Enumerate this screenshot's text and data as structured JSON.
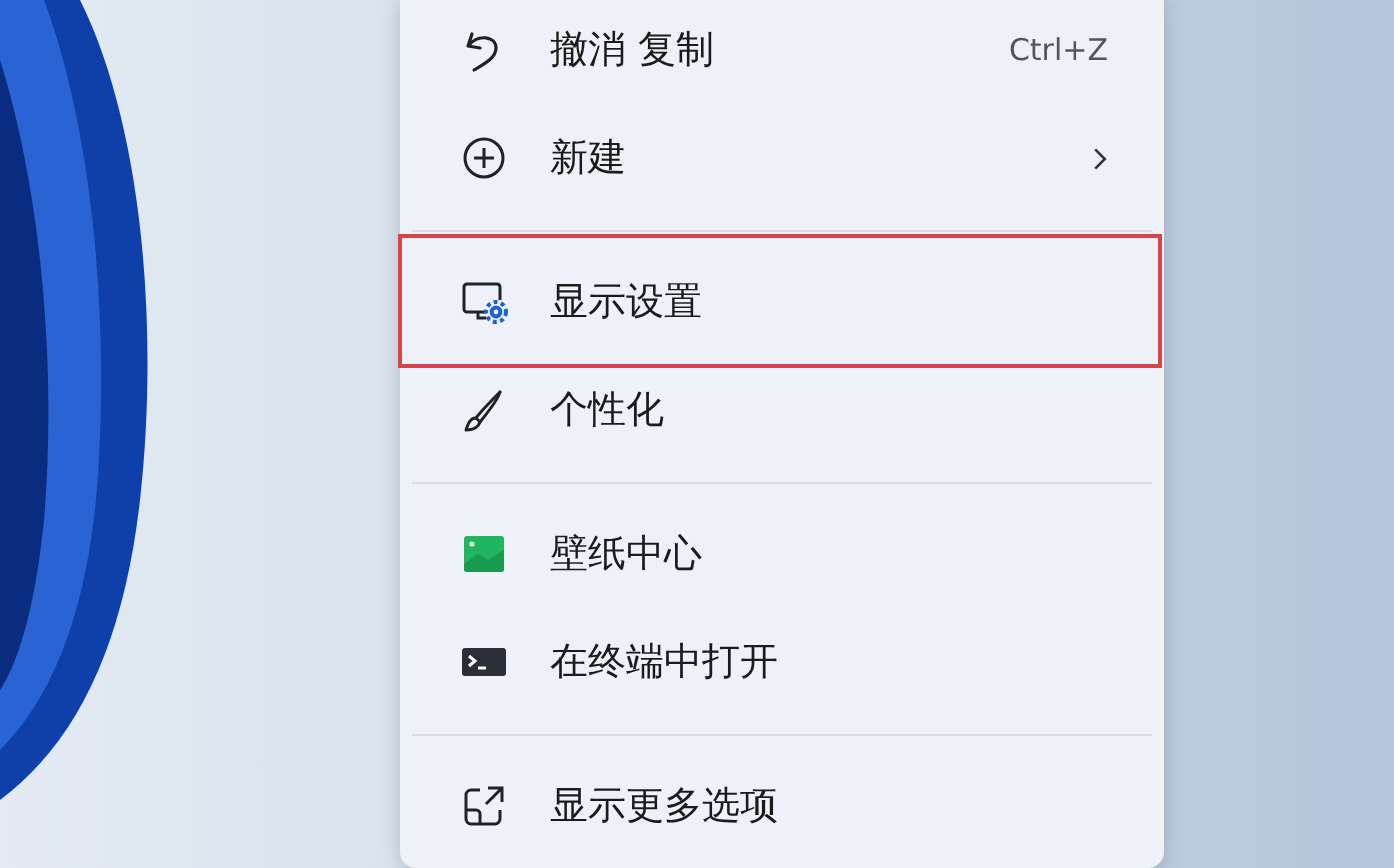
{
  "context_menu": {
    "entries": [
      {
        "kind": "item",
        "label": "撤消 复制",
        "shortcut": "Ctrl+Z",
        "submenu": false,
        "highlighted": false
      },
      {
        "kind": "item",
        "label": "新建",
        "submenu": true,
        "highlighted": false
      },
      {
        "kind": "separator"
      },
      {
        "kind": "item",
        "label": "显示设置",
        "submenu": false,
        "highlighted": true
      },
      {
        "kind": "item",
        "label": "个性化",
        "submenu": false,
        "highlighted": false
      },
      {
        "kind": "separator"
      },
      {
        "kind": "item",
        "label": "壁纸中心",
        "submenu": false,
        "highlighted": false
      },
      {
        "kind": "item",
        "label": "在终端中打开",
        "submenu": false,
        "highlighted": false
      },
      {
        "kind": "separator"
      },
      {
        "kind": "item",
        "label": "显示更多选项",
        "submenu": false,
        "highlighted": false
      }
    ]
  }
}
